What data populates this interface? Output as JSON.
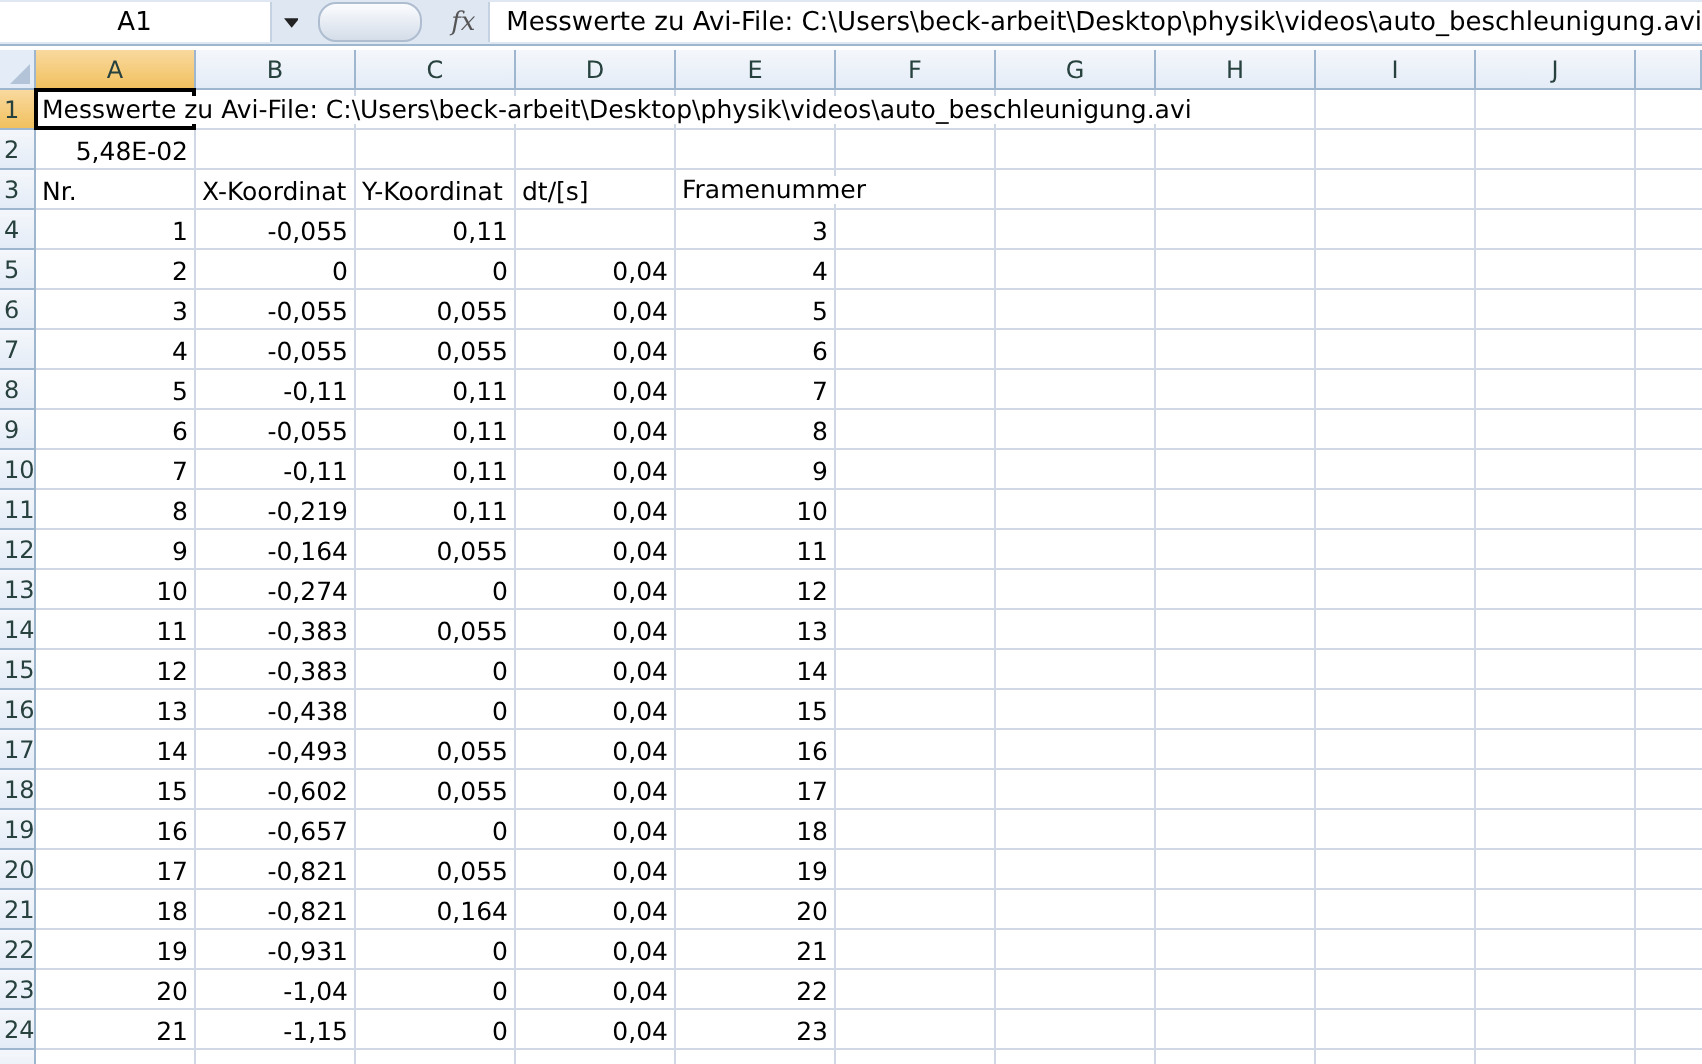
{
  "name_box": "A1",
  "function_label": "fx",
  "formula": "Messwerte zu Avi-File: C:\\Users\\beck-arbeit\\Desktop\\physik\\videos\\auto_beschleunigung.avi",
  "columns": [
    {
      "label": "A",
      "selected": true
    },
    {
      "label": "B",
      "selected": false
    },
    {
      "label": "C",
      "selected": false
    },
    {
      "label": "D",
      "selected": false
    },
    {
      "label": "E",
      "selected": false
    },
    {
      "label": "F",
      "selected": false
    },
    {
      "label": "G",
      "selected": false
    },
    {
      "label": "H",
      "selected": false
    },
    {
      "label": "I",
      "selected": false
    },
    {
      "label": "J",
      "selected": false
    }
  ],
  "rows": [
    {
      "number": "1",
      "selected": true,
      "kind": "text",
      "cells": [
        "Messwerte zu Avi-File: C:\\Users\\beck-arbeit\\Desktop\\physik\\videos\\auto_beschleunigung.avi"
      ]
    },
    {
      "number": "2",
      "selected": false,
      "kind": "number",
      "cells": [
        "5,48E-02"
      ]
    },
    {
      "number": "3",
      "selected": false,
      "kind": "text",
      "cells": [
        "Nr.",
        "X-Koordinat",
        "Y-Koordinat",
        "dt/[s]",
        "Framenummer"
      ]
    },
    {
      "number": "4",
      "selected": false,
      "kind": "number",
      "cells": [
        "1",
        "-0,055",
        "0,11",
        null,
        "3"
      ]
    },
    {
      "number": "5",
      "selected": false,
      "kind": "number",
      "cells": [
        "2",
        "0",
        "0",
        "0,04",
        "4"
      ]
    },
    {
      "number": "6",
      "selected": false,
      "kind": "number",
      "cells": [
        "3",
        "-0,055",
        "0,055",
        "0,04",
        "5"
      ]
    },
    {
      "number": "7",
      "selected": false,
      "kind": "number",
      "cells": [
        "4",
        "-0,055",
        "0,055",
        "0,04",
        "6"
      ]
    },
    {
      "number": "8",
      "selected": false,
      "kind": "number",
      "cells": [
        "5",
        "-0,11",
        "0,11",
        "0,04",
        "7"
      ]
    },
    {
      "number": "9",
      "selected": false,
      "kind": "number",
      "cells": [
        "6",
        "-0,055",
        "0,11",
        "0,04",
        "8"
      ]
    },
    {
      "number": "10",
      "selected": false,
      "kind": "number",
      "cells": [
        "7",
        "-0,11",
        "0,11",
        "0,04",
        "9"
      ]
    },
    {
      "number": "11",
      "selected": false,
      "kind": "number",
      "cells": [
        "8",
        "-0,219",
        "0,11",
        "0,04",
        "10"
      ]
    },
    {
      "number": "12",
      "selected": false,
      "kind": "number",
      "cells": [
        "9",
        "-0,164",
        "0,055",
        "0,04",
        "11"
      ]
    },
    {
      "number": "13",
      "selected": false,
      "kind": "number",
      "cells": [
        "10",
        "-0,274",
        "0",
        "0,04",
        "12"
      ]
    },
    {
      "number": "14",
      "selected": false,
      "kind": "number",
      "cells": [
        "11",
        "-0,383",
        "0,055",
        "0,04",
        "13"
      ]
    },
    {
      "number": "15",
      "selected": false,
      "kind": "number",
      "cells": [
        "12",
        "-0,383",
        "0",
        "0,04",
        "14"
      ]
    },
    {
      "number": "16",
      "selected": false,
      "kind": "number",
      "cells": [
        "13",
        "-0,438",
        "0",
        "0,04",
        "15"
      ]
    },
    {
      "number": "17",
      "selected": false,
      "kind": "number",
      "cells": [
        "14",
        "-0,493",
        "0,055",
        "0,04",
        "16"
      ]
    },
    {
      "number": "18",
      "selected": false,
      "kind": "number",
      "cells": [
        "15",
        "-0,602",
        "0,055",
        "0,04",
        "17"
      ]
    },
    {
      "number": "19",
      "selected": false,
      "kind": "number",
      "cells": [
        "16",
        "-0,657",
        "0",
        "0,04",
        "18"
      ]
    },
    {
      "number": "20",
      "selected": false,
      "kind": "number",
      "cells": [
        "17",
        "-0,821",
        "0,055",
        "0,04",
        "19"
      ]
    },
    {
      "number": "21",
      "selected": false,
      "kind": "number",
      "cells": [
        "18",
        "-0,821",
        "0,164",
        "0,04",
        "20"
      ]
    },
    {
      "number": "22",
      "selected": false,
      "kind": "number",
      "cells": [
        "19",
        "-0,931",
        "0",
        "0,04",
        "21"
      ]
    },
    {
      "number": "23",
      "selected": false,
      "kind": "number",
      "cells": [
        "20",
        "-1,04",
        "0",
        "0,04",
        "22"
      ]
    },
    {
      "number": "24",
      "selected": false,
      "kind": "number",
      "cells": [
        "21",
        "-1,15",
        "0",
        "0,04",
        "23"
      ]
    }
  ]
}
